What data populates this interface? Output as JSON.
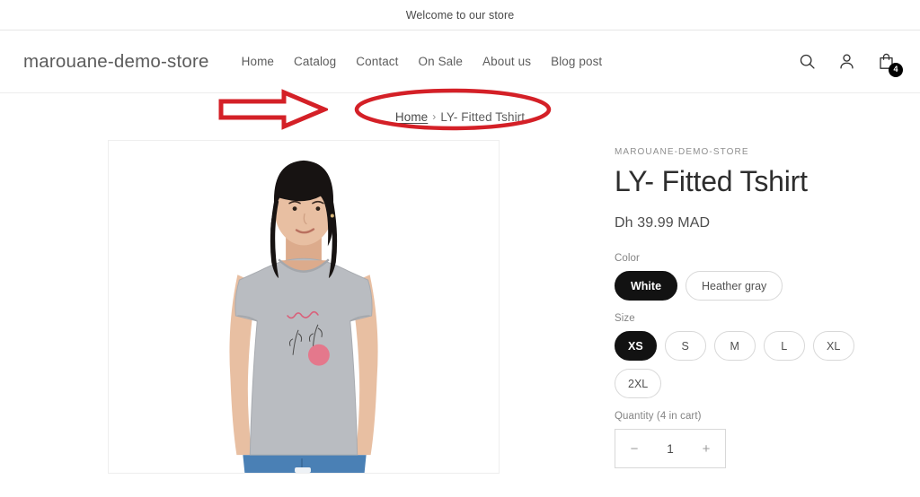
{
  "announcement": {
    "text": "Welcome to our store"
  },
  "header": {
    "logo": "marouane-demo-store",
    "nav": [
      {
        "label": "Home"
      },
      {
        "label": "Catalog"
      },
      {
        "label": "Contact"
      },
      {
        "label": "On Sale"
      },
      {
        "label": "About us"
      },
      {
        "label": "Blog post"
      }
    ],
    "icons": {
      "search": "search-icon",
      "account": "account-icon",
      "cart": "cart-icon"
    },
    "cart_count": "4"
  },
  "breadcrumb": {
    "home": "Home",
    "separator": "›",
    "current": "LY- Fitted Tshirt"
  },
  "annotations": {
    "arrow_color": "#d42027",
    "ellipse_color": "#d42027"
  },
  "product": {
    "vendor": "MAROUANE-DEMO-STORE",
    "title": "LY- Fitted Tshirt",
    "price": "Dh 39.99 MAD",
    "color": {
      "label": "Color",
      "options": [
        {
          "label": "White",
          "selected": true
        },
        {
          "label": "Heather gray",
          "selected": false
        }
      ]
    },
    "size": {
      "label": "Size",
      "options": [
        {
          "label": "XS",
          "selected": true
        },
        {
          "label": "S",
          "selected": false
        },
        {
          "label": "M",
          "selected": false
        },
        {
          "label": "L",
          "selected": false
        },
        {
          "label": "XL",
          "selected": false
        },
        {
          "label": "2XL",
          "selected": false
        }
      ]
    },
    "quantity": {
      "label": "Quantity (4 in cart)",
      "value": "1",
      "decrease": "−",
      "increase": "+"
    },
    "image_alt": "model-wearing-heather-gray-fitted-tshirt"
  }
}
